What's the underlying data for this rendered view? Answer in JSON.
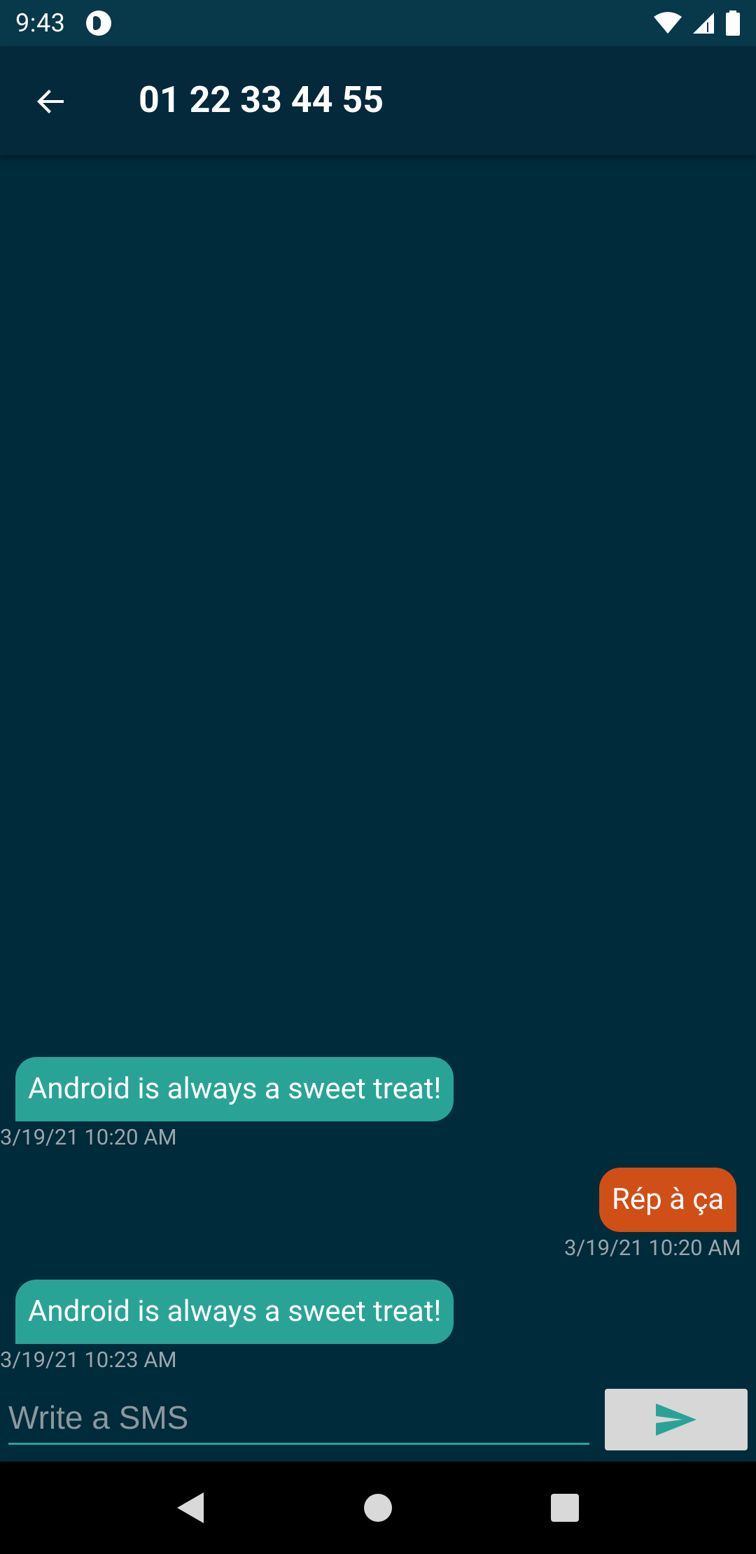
{
  "status_bar": {
    "time": "9:43",
    "icons": [
      "notification-app-icon",
      "wifi-icon",
      "signal-icon",
      "battery-icon"
    ]
  },
  "app_bar": {
    "back_icon": "arrow-left-icon",
    "title": "01 22 33 44 55"
  },
  "messages": [
    {
      "direction": "incoming",
      "text": "Android is always a sweet treat!",
      "timestamp": "3/19/21 10:20 AM"
    },
    {
      "direction": "outgoing",
      "text": "Rép à ça",
      "timestamp": "3/19/21 10:20 AM"
    },
    {
      "direction": "incoming",
      "text": "Android is always a sweet treat!",
      "timestamp": "3/19/21 10:23 AM"
    }
  ],
  "composer": {
    "placeholder": "Write a SMS",
    "value": "",
    "send_icon": "send-icon"
  },
  "nav_bar": {
    "icons": [
      "back-triangle-icon",
      "home-circle-icon",
      "recents-square-icon"
    ]
  },
  "colors": {
    "background": "#002b3a",
    "app_bar": "#03293a",
    "status_bar": "#07394a",
    "incoming_bubble": "#2aa397",
    "outgoing_bubble": "#cf4f17",
    "timestamp": "#9aa6ad",
    "accent": "#2aa397"
  }
}
